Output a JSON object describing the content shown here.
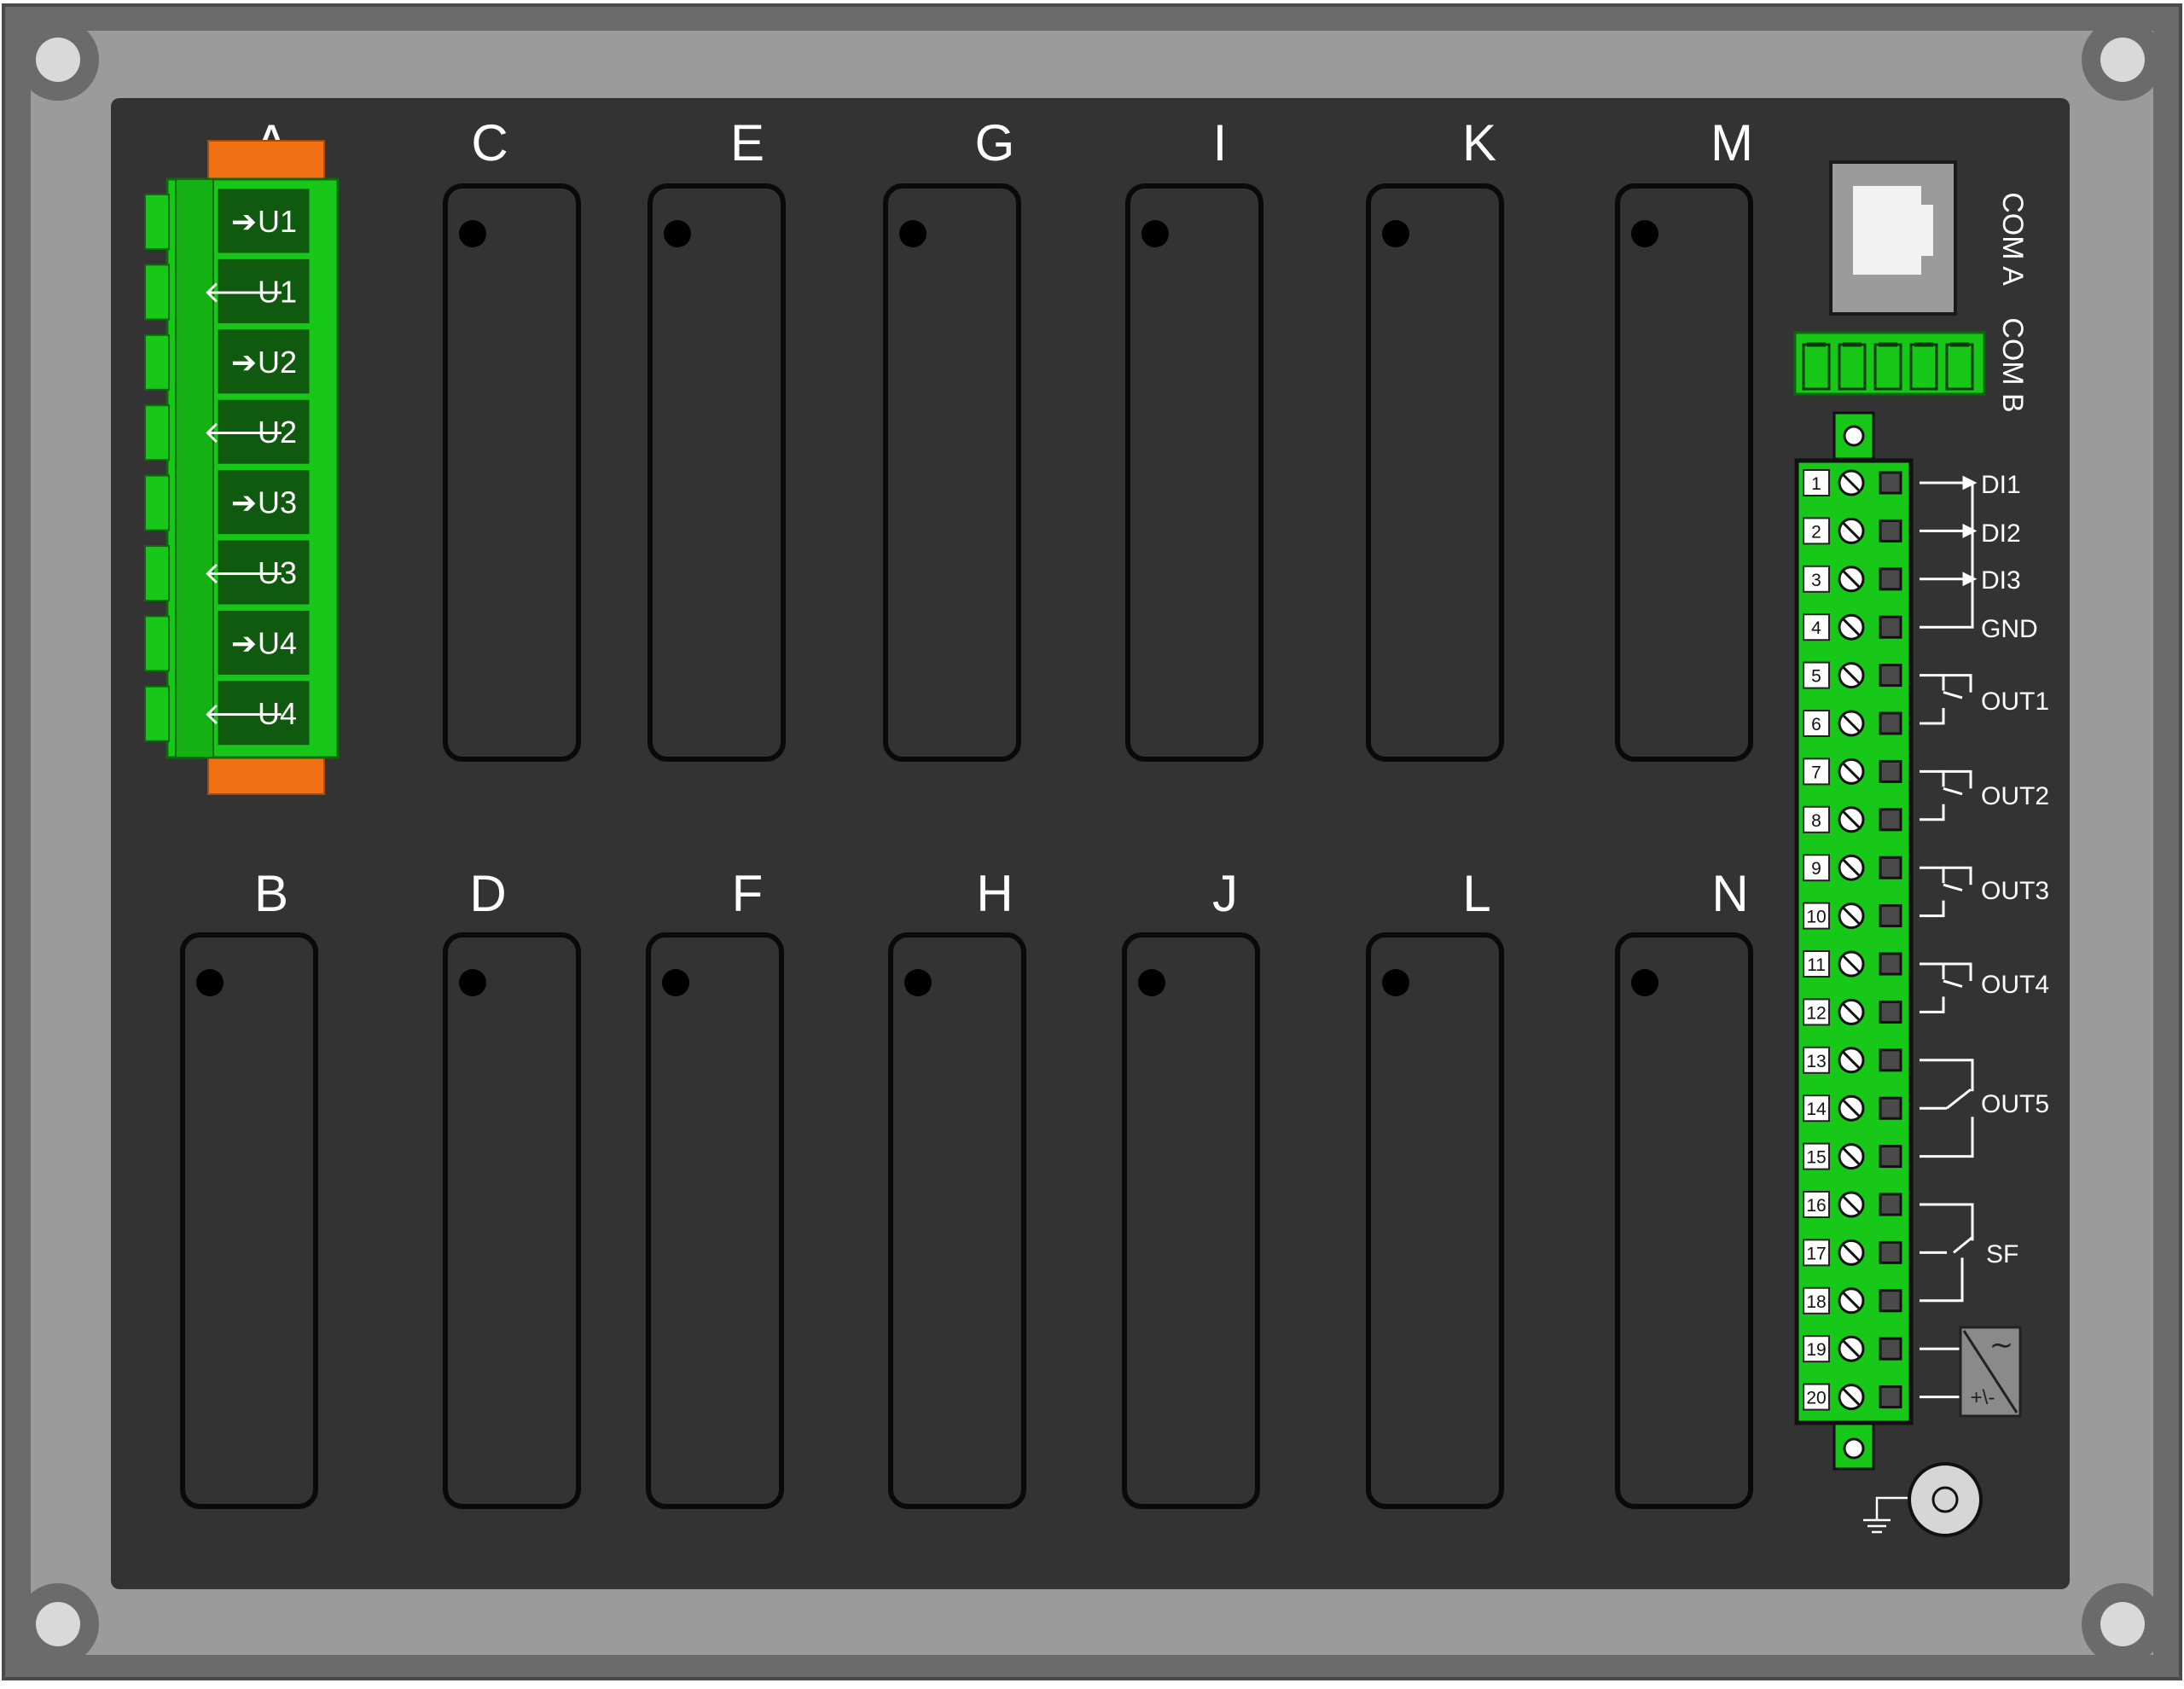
{
  "slots": {
    "top": [
      {
        "id": "A",
        "label": "A",
        "status": "occupied"
      },
      {
        "id": "C",
        "label": "C",
        "status": "empty"
      },
      {
        "id": "E",
        "label": "E",
        "status": "empty"
      },
      {
        "id": "G",
        "label": "G",
        "status": "empty"
      },
      {
        "id": "I",
        "label": "I",
        "status": "empty"
      },
      {
        "id": "K",
        "label": "K",
        "status": "empty"
      },
      {
        "id": "M",
        "label": "M",
        "status": "empty"
      }
    ],
    "bottom": [
      {
        "id": "B",
        "label": "B",
        "status": "empty"
      },
      {
        "id": "D",
        "label": "D",
        "status": "empty"
      },
      {
        "id": "F",
        "label": "F",
        "status": "empty"
      },
      {
        "id": "H",
        "label": "H",
        "status": "empty"
      },
      {
        "id": "J",
        "label": "J",
        "status": "empty"
      },
      {
        "id": "L",
        "label": "L",
        "status": "empty"
      },
      {
        "id": "N",
        "label": "N",
        "status": "empty"
      }
    ]
  },
  "module_a_pins": [
    {
      "arrow": "➔",
      "label": "U1"
    },
    {
      "arrow": "🡐",
      "label": "U1"
    },
    {
      "arrow": "➔",
      "label": "U2"
    },
    {
      "arrow": "🡐",
      "label": "U2"
    },
    {
      "arrow": "➔",
      "label": "U3"
    },
    {
      "arrow": "🡐",
      "label": "U3"
    },
    {
      "arrow": "➔",
      "label": "U4"
    },
    {
      "arrow": "🡐",
      "label": "U4"
    }
  ],
  "com_ports": {
    "com_a": "COM A",
    "com_b": "COM B"
  },
  "terminal_numbers": [
    "1",
    "2",
    "3",
    "4",
    "5",
    "6",
    "7",
    "8",
    "9",
    "10",
    "11",
    "12",
    "13",
    "14",
    "15",
    "16",
    "17",
    "18",
    "19",
    "20"
  ],
  "io_labels": {
    "di1": "DI1",
    "di2": "DI2",
    "di3": "DI3",
    "gnd": "GND",
    "out1": "OUT1",
    "out2": "OUT2",
    "out3": "OUT3",
    "out4": "OUT4",
    "out5": "OUT5",
    "sf": "SF"
  },
  "power_symbol": {
    "ac": "∼",
    "dc": "+\\-"
  },
  "colors": {
    "frame_dark": "#6a6a6a",
    "frame_light": "#9b9b9b",
    "panel": "#333333",
    "terminal_green": "#18d018",
    "connector_orange": "#f27014",
    "label_white": "#ffffff"
  }
}
